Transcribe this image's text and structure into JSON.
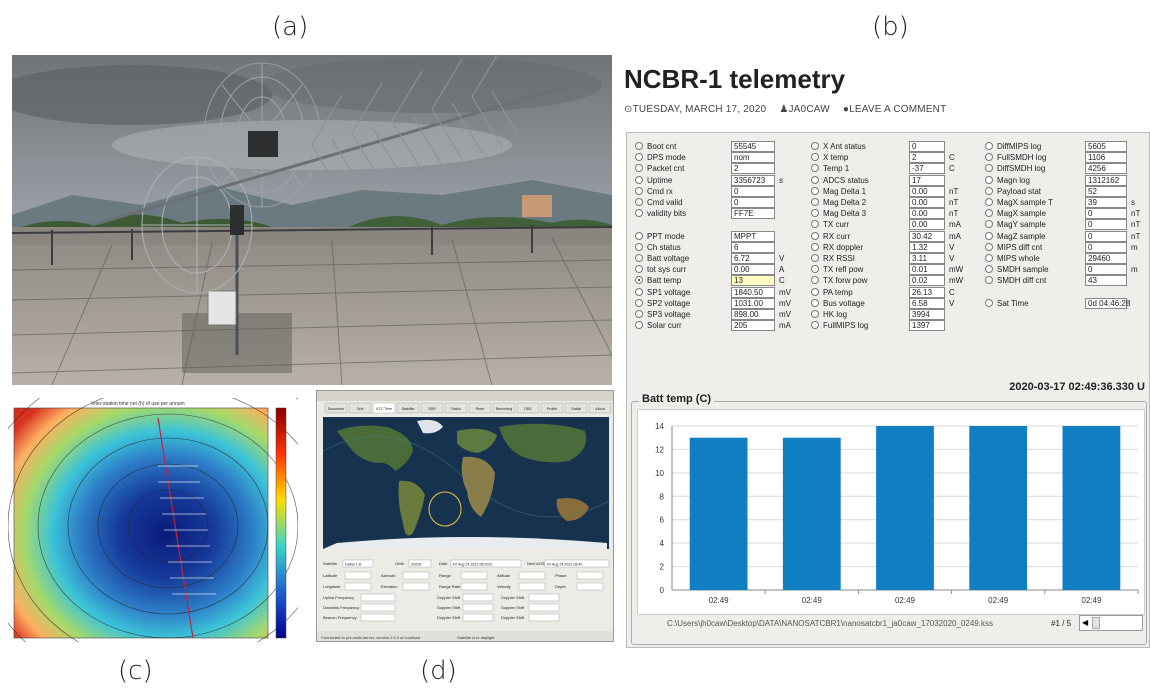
{
  "panel_labels": {
    "a": "(a)",
    "b": "(b)",
    "c": "(c)",
    "d": "(d)"
  },
  "telemetry": {
    "title": "NCBR-1 telemetry",
    "meta": {
      "date": "TUESDAY, MARCH 17, 2020",
      "author": "JA0CAW",
      "comment": "LEAVE A COMMENT"
    },
    "columns": [
      [
        {
          "label": "Boot cnt",
          "value": "55545",
          "unit": ""
        },
        {
          "label": "DPS mode",
          "value": "nom",
          "unit": ""
        },
        {
          "label": "Packet cnt",
          "value": "2",
          "unit": ""
        },
        {
          "label": "Uptime",
          "value": "3356723",
          "unit": "s"
        },
        {
          "label": "Cmd rx",
          "value": "0",
          "unit": ""
        },
        {
          "label": "Cmd valid",
          "value": "0",
          "unit": ""
        },
        {
          "label": "validity bits",
          "value": "FF7E",
          "unit": ""
        },
        {
          "label": "",
          "value": "",
          "unit": "",
          "spacer": true
        },
        {
          "label": "PPT mode",
          "value": "MPPT",
          "unit": ""
        },
        {
          "label": "Ch status",
          "value": "6",
          "unit": ""
        },
        {
          "label": "Batt voltage",
          "value": "6.72",
          "unit": "V"
        },
        {
          "label": "tot sys curr",
          "value": "0.00",
          "unit": "A"
        },
        {
          "label": "Batt temp",
          "value": "13",
          "unit": "C",
          "checked": true,
          "highlight": true
        },
        {
          "label": "SP1 voltage",
          "value": "1840.50",
          "unit": "mV"
        },
        {
          "label": "SP2 voltage",
          "value": "1031.00",
          "unit": "mV"
        },
        {
          "label": "SP3 voltage",
          "value": "898.00",
          "unit": "mV"
        },
        {
          "label": "Solar curr",
          "value": "205",
          "unit": "mA"
        }
      ],
      [
        {
          "label": "X Ant status",
          "value": "0",
          "unit": ""
        },
        {
          "label": "X temp",
          "value": "2",
          "unit": "C"
        },
        {
          "label": "Temp 1",
          "value": "-37",
          "unit": "C"
        },
        {
          "label": "ADCS status",
          "value": "17",
          "unit": ""
        },
        {
          "label": "Mag Delta 1",
          "value": "0.00",
          "unit": "nT"
        },
        {
          "label": "Mag Delta 2",
          "value": "0.00",
          "unit": "nT"
        },
        {
          "label": "Mag Delta 3",
          "value": "0.00",
          "unit": "nT"
        },
        {
          "label": "TX curr",
          "value": "0.00",
          "unit": "mA"
        },
        {
          "label": "RX curr",
          "value": "30.42",
          "unit": "mA"
        },
        {
          "label": "RX doppler",
          "value": "1.32",
          "unit": "V"
        },
        {
          "label": "RX RSSI",
          "value": "3.11",
          "unit": "V"
        },
        {
          "label": "TX refl pow",
          "value": "0.01",
          "unit": "mW"
        },
        {
          "label": "TX forw pow",
          "value": "0.02",
          "unit": "mW"
        },
        {
          "label": "PA temp",
          "value": "26.13",
          "unit": "C"
        },
        {
          "label": "Bus voltage",
          "value": "6.58",
          "unit": "V"
        },
        {
          "label": "HK log",
          "value": "3994",
          "unit": ""
        },
        {
          "label": "FullMIPS log",
          "value": "1397",
          "unit": ""
        }
      ],
      [
        {
          "label": "DiffMIPS log",
          "value": "5605",
          "unit": ""
        },
        {
          "label": "FullSMDH log",
          "value": "1106",
          "unit": ""
        },
        {
          "label": "DiffSMDH log",
          "value": "4256",
          "unit": ""
        },
        {
          "label": "Magn log",
          "value": "1312162",
          "unit": ""
        },
        {
          "label": "Payload stat",
          "value": "52",
          "unit": ""
        },
        {
          "label": "MagX sample T",
          "value": "39",
          "unit": "s"
        },
        {
          "label": "MagX sample",
          "value": "0",
          "unit": "nT"
        },
        {
          "label": "MagY sample",
          "value": "0",
          "unit": "nT"
        },
        {
          "label": "MagZ sample",
          "value": "0",
          "unit": "nT"
        },
        {
          "label": "MIPS diff cnt",
          "value": "0",
          "unit": "m"
        },
        {
          "label": "MIPS whole",
          "value": "29460",
          "unit": ""
        },
        {
          "label": "SMDH sample",
          "value": "0",
          "unit": "m"
        },
        {
          "label": "SMDH diff cnt",
          "value": "43",
          "unit": ""
        },
        {
          "label": "",
          "value": "",
          "unit": "",
          "spacer": true
        },
        {
          "label": "Sat Time",
          "value": "0d 04:46:28",
          "unit": ""
        }
      ]
    ],
    "timestamp": "2020-03-17 02:49:36.330 U",
    "chart_title": "Batt temp (C)",
    "file_path": "C:\\Users\\jh0caw\\Desktop\\DATA\\NANOSATCBR1\\nanosatcbr1_ja0caw_17032020_0249.kss",
    "pager": "#1 / 5",
    "chart_data": {
      "type": "bar",
      "title": "Batt temp (C)",
      "categories": [
        "02:49",
        "02:49",
        "02:49",
        "02:49",
        "02:49"
      ],
      "values": [
        13,
        13,
        14,
        14,
        14
      ],
      "ylim": [
        0,
        14
      ],
      "yticks": [
        "0",
        "2",
        "4",
        "6",
        "8",
        "10",
        "12",
        "14"
      ],
      "color": "#0f7fc1",
      "grid": true
    }
  },
  "tracker": {
    "tabs": [
      "Document",
      "Grid",
      "UTC Time",
      "Satellite",
      "SDR",
      "Radio",
      "Rotor",
      "Recording",
      "DDE",
      "Profile",
      "Satdb",
      "About"
    ],
    "satellite_label": "Satellite",
    "satellite_value": "DaMa 1 B",
    "orbit_label": "Orbit",
    "orbit_value": "20228",
    "date_label": "Date",
    "date_value": "Fri Aug 24 2021 08:2022",
    "next_aos_label": "Next AOS",
    "next_aos_value": "Fri Aug 24 2021 08:40",
    "row2": [
      "Latitude",
      "Azimuth",
      "Range",
      "Altitude",
      "Phase"
    ],
    "row3": [
      "Longitude",
      "Elevation",
      "Range Rate",
      "Velocity",
      "Depth"
    ],
    "freq_labels": [
      "Uplink Frequency",
      "Downlink Frequency",
      "Beacon Frequency"
    ],
    "doppler_labels": [
      "Doppler Shift",
      "Doppler Shift",
      "Doppler Shift"
    ],
    "footer_left": "Connected to pre-radio server, version 2.0.0 at localhost",
    "footer_right": "Satellite is in daylight"
  },
  "contour": {
    "title": "Inter-station time net (h) of use per annum"
  }
}
